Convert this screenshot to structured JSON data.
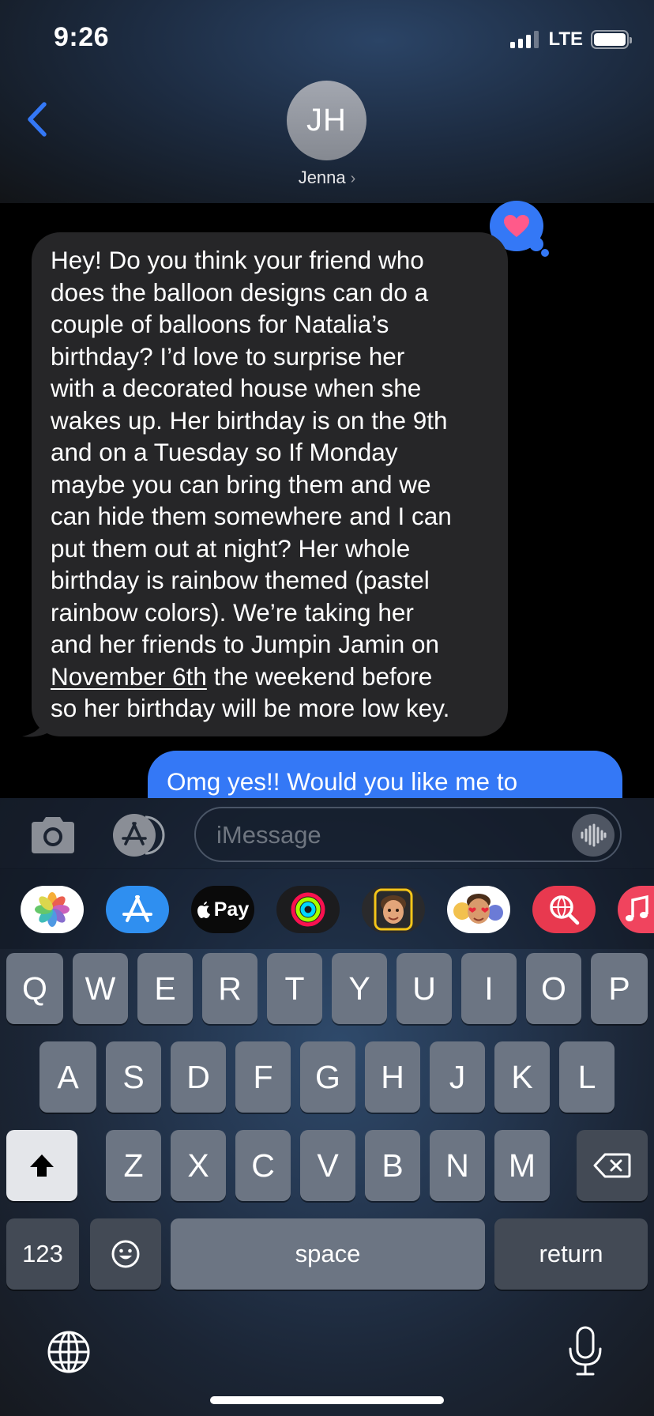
{
  "status_bar": {
    "time": "9:26",
    "network": "LTE"
  },
  "header": {
    "avatar_initials": "JH",
    "contact_name": "Jenna",
    "contact_chevron": "›"
  },
  "messages": {
    "incoming": {
      "lines": [
        "Hey! Do you think your friend who",
        "does the balloon designs can do a",
        "couple of balloons for Natalia’s",
        "birthday? I’d love to surprise her",
        "with a decorated house when she",
        "wakes up. Her birthday is on the 9th",
        "and on a Tuesday so If Monday",
        "maybe you can bring them and we",
        "can hide them somewhere and I can",
        "put them out at night? Her whole",
        "birthday is rainbow themed (pastel",
        "rainbow colors). We’re taking her",
        "and her friends to Jumpin Jamin on"
      ],
      "date_link": "November 6th",
      "line_after_link": " the weekend before",
      "last_line": "so her birthday will be more low key.",
      "reaction": "heart-icon"
    },
    "outgoing": {
      "text": "Omg yes!! Would you like me to"
    }
  },
  "input_bar": {
    "placeholder": "iMessage"
  },
  "app_strip": {
    "items": [
      "photos",
      "app-store",
      "apple-pay",
      "activity",
      "memoji",
      "memoji-stickers",
      "search-images",
      "music"
    ],
    "apple_pay_label": "Pay"
  },
  "keyboard": {
    "row1": [
      "Q",
      "W",
      "E",
      "R",
      "T",
      "Y",
      "U",
      "I",
      "O",
      "P"
    ],
    "row2": [
      "A",
      "S",
      "D",
      "F",
      "G",
      "H",
      "J",
      "K",
      "L"
    ],
    "row3": [
      "Z",
      "X",
      "C",
      "V",
      "B",
      "N",
      "M"
    ],
    "numbers_label": "123",
    "space_label": "space",
    "return_label": "return"
  },
  "colors": {
    "imessage_blue": "#3478f6",
    "incoming_bubble": "#262628",
    "key": "#6c7583",
    "key_dark": "#434a55",
    "accent_pink": "#ff5a8a"
  }
}
